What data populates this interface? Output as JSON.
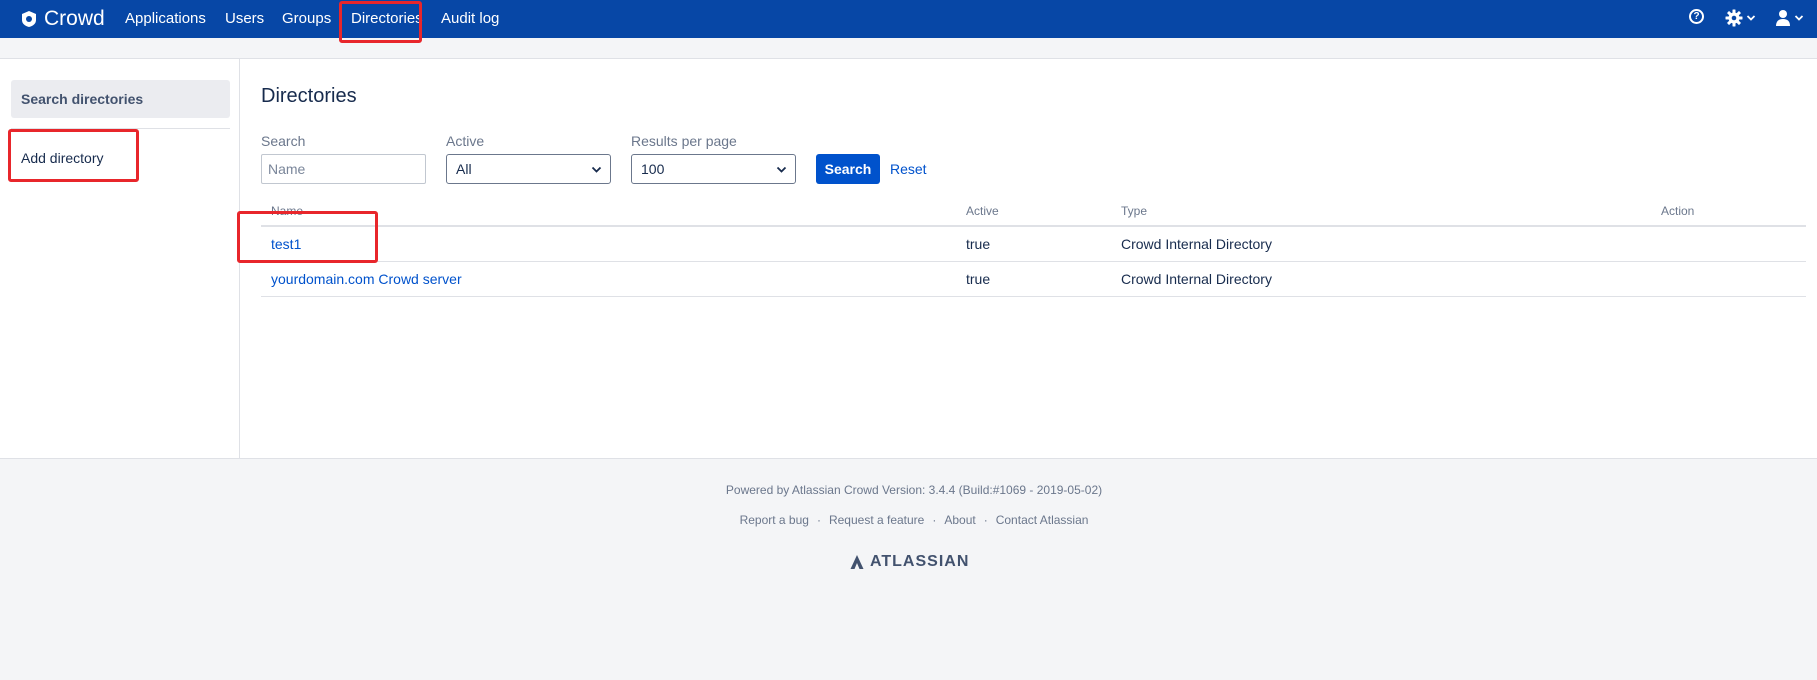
{
  "header": {
    "brand": "Crowd",
    "nav": [
      "Applications",
      "Users",
      "Groups",
      "Directories",
      "Audit log"
    ],
    "active_nav": "Directories",
    "icons": [
      "help-icon",
      "gear-icon",
      "user-icon"
    ]
  },
  "sidebar": {
    "items": [
      {
        "label": "Search directories",
        "active": true
      },
      {
        "label": "Add directory",
        "active": false
      }
    ]
  },
  "main": {
    "title": "Directories",
    "filters": {
      "search_label": "Search",
      "search_placeholder": "Name",
      "search_value": "",
      "active_label": "Active",
      "active_value": "All",
      "results_label": "Results per page",
      "results_value": "100",
      "search_button": "Search",
      "reset_link": "Reset"
    },
    "table": {
      "columns": [
        "Name",
        "Active",
        "Type",
        "Action"
      ],
      "rows": [
        {
          "name": "test1",
          "active": "true",
          "type": "Crowd Internal Directory"
        },
        {
          "name": "yourdomain.com Crowd server",
          "active": "true",
          "type": "Crowd Internal Directory"
        }
      ]
    }
  },
  "footer": {
    "powered": "Powered by Atlassian Crowd Version: 3.4.4 (Build:#1069 - 2019-05-02)",
    "links": [
      "Report a bug",
      "Request a feature",
      "About",
      "Contact Atlassian"
    ],
    "separator": "·",
    "logo": "ATLASSIAN"
  },
  "colors": {
    "topbar": "#0747a6",
    "primary": "#0052cc",
    "highlight": "#e8262b",
    "page_bg": "#f4f5f7"
  }
}
